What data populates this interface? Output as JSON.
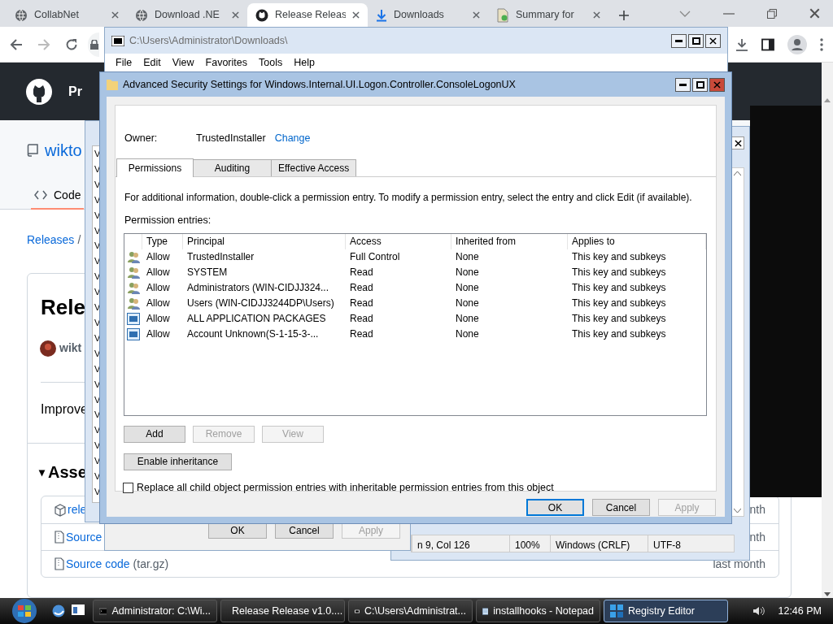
{
  "browser": {
    "tabs": [
      {
        "label": "CollabNet",
        "kind": "globe",
        "selected": false
      },
      {
        "label": "Download .NE",
        "kind": "globe",
        "selected": false
      },
      {
        "label": "Release Releas",
        "kind": "github",
        "selected": true
      },
      {
        "label": "Downloads",
        "kind": "download",
        "selected": false
      },
      {
        "label": "Summary for",
        "kind": "doc",
        "selected": false
      }
    ],
    "page": {
      "header_text": "Pr",
      "repo_name": "wikto",
      "nav_tab": "Code",
      "breadcrumb_link": "Releases",
      "breadcrumb_rest": "/",
      "release_title": "Rele",
      "author": "wikt",
      "body": "Improve",
      "assets_toggle": "▾",
      "assets_heading": "Asse",
      "assets": [
        {
          "name": "rele",
          "kind": "package",
          "time": "nth"
        },
        {
          "name": "Source",
          "kind": "zip",
          "time": "nth"
        },
        {
          "name": "Source code",
          "suffix": "(tar.gz)",
          "kind": "zip",
          "time": "last month"
        }
      ]
    }
  },
  "notepad": {
    "list_items": [
      "V",
      "V",
      "V",
      "V",
      "V",
      "V",
      "V",
      "V",
      "V",
      "V",
      "V",
      "V",
      "V",
      "V",
      "V",
      "V",
      "V",
      "V",
      "V",
      "V",
      "V",
      "V",
      "V"
    ],
    "status": [
      "n 9, Col 126",
      "100%",
      "Windows (CRLF)",
      "UTF-8"
    ]
  },
  "properties_dialog": {
    "buttons": [
      {
        "label": "OK",
        "disabled": false
      },
      {
        "label": "Cancel",
        "disabled": false
      },
      {
        "label": "Apply",
        "disabled": true
      }
    ]
  },
  "seven_zip": {
    "title": "C:\\Users\\Administrator\\Downloads\\",
    "menu": [
      "File",
      "Edit",
      "View",
      "Favorites",
      "Tools",
      "Help"
    ]
  },
  "security_dialog": {
    "title": "Advanced Security Settings for Windows.Internal.UI.Logon.Controller.ConsoleLogonUX",
    "owner_label": "Owner:",
    "owner": "TrustedInstaller",
    "change_link": "Change",
    "tabs": [
      {
        "label": "Permissions",
        "selected": true
      },
      {
        "label": "Auditing",
        "selected": false
      },
      {
        "label": "Effective Access",
        "selected": false
      }
    ],
    "info": "For additional information, double-click a permission entry. To modify a permission entry, select the entry and click Edit (if available).",
    "entries_label": "Permission entries:",
    "columns": [
      "Type",
      "Principal",
      "Access",
      "Inherited from",
      "Applies to"
    ],
    "rows": [
      {
        "kind": "group",
        "type": "Allow",
        "principal": "TrustedInstaller",
        "access": "Full Control",
        "inherited": "None",
        "applies": "This key and subkeys"
      },
      {
        "kind": "group",
        "type": "Allow",
        "principal": "SYSTEM",
        "access": "Read",
        "inherited": "None",
        "applies": "This key and subkeys"
      },
      {
        "kind": "group",
        "type": "Allow",
        "principal": "Administrators (WIN-CIDJJ324...",
        "access": "Read",
        "inherited": "None",
        "applies": "This key and subkeys"
      },
      {
        "kind": "group",
        "type": "Allow",
        "principal": "Users (WIN-CIDJJ3244DP\\Users)",
        "access": "Read",
        "inherited": "None",
        "applies": "This key and subkeys"
      },
      {
        "kind": "package",
        "type": "Allow",
        "principal": "ALL APPLICATION PACKAGES",
        "access": "Read",
        "inherited": "None",
        "applies": "This key and subkeys"
      },
      {
        "kind": "package",
        "type": "Allow",
        "principal": "Account Unknown(S-1-15-3-...",
        "access": "Read",
        "inherited": "None",
        "applies": "This key and subkeys"
      }
    ],
    "list_buttons": [
      {
        "label": "Add",
        "disabled": false
      },
      {
        "label": "Remove",
        "disabled": true
      },
      {
        "label": "View",
        "disabled": true
      }
    ],
    "inheritance_button": "Enable inheritance",
    "replace_checkbox": {
      "label": "Replace all child object permission entries with inheritable permission entries from this object",
      "checked": false
    },
    "buttons": [
      {
        "label": "OK",
        "disabled": false,
        "default": true
      },
      {
        "label": "Cancel",
        "disabled": false,
        "default": false
      },
      {
        "label": "Apply",
        "disabled": true,
        "default": false
      }
    ]
  },
  "taskbar": {
    "items": [
      {
        "label": "Administrator: C:\\Wi...",
        "kind": "console",
        "selected": false
      },
      {
        "label": "Release Release v1.0....",
        "kind": "browser",
        "selected": false
      },
      {
        "label": "C:\\Users\\Administrat...",
        "kind": "archive",
        "selected": false
      },
      {
        "label": "installhooks - Notepad",
        "kind": "notepad",
        "selected": false
      },
      {
        "label": "Registry Editor",
        "kind": "registry",
        "selected": true
      }
    ],
    "clock": "12:46 PM"
  }
}
